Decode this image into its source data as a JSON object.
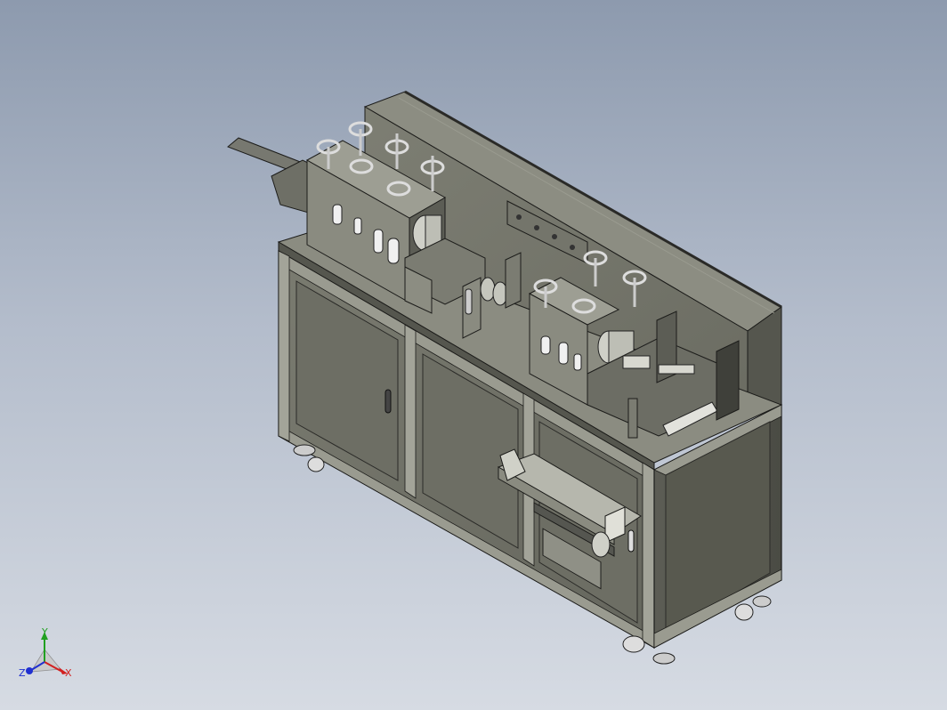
{
  "triad": {
    "x_label": "X",
    "y_label": "Y",
    "z_label": "Z",
    "x_color": "#d22020",
    "y_color": "#20a020",
    "z_color": "#2030d0"
  },
  "colors": {
    "background_top": "#8d9aae",
    "background_bottom": "#d6dbe3",
    "machine_face": "#6f7066",
    "machine_light": "#8a8b80",
    "machine_dark": "#4d4e47",
    "edge": "#1c1c1a"
  }
}
